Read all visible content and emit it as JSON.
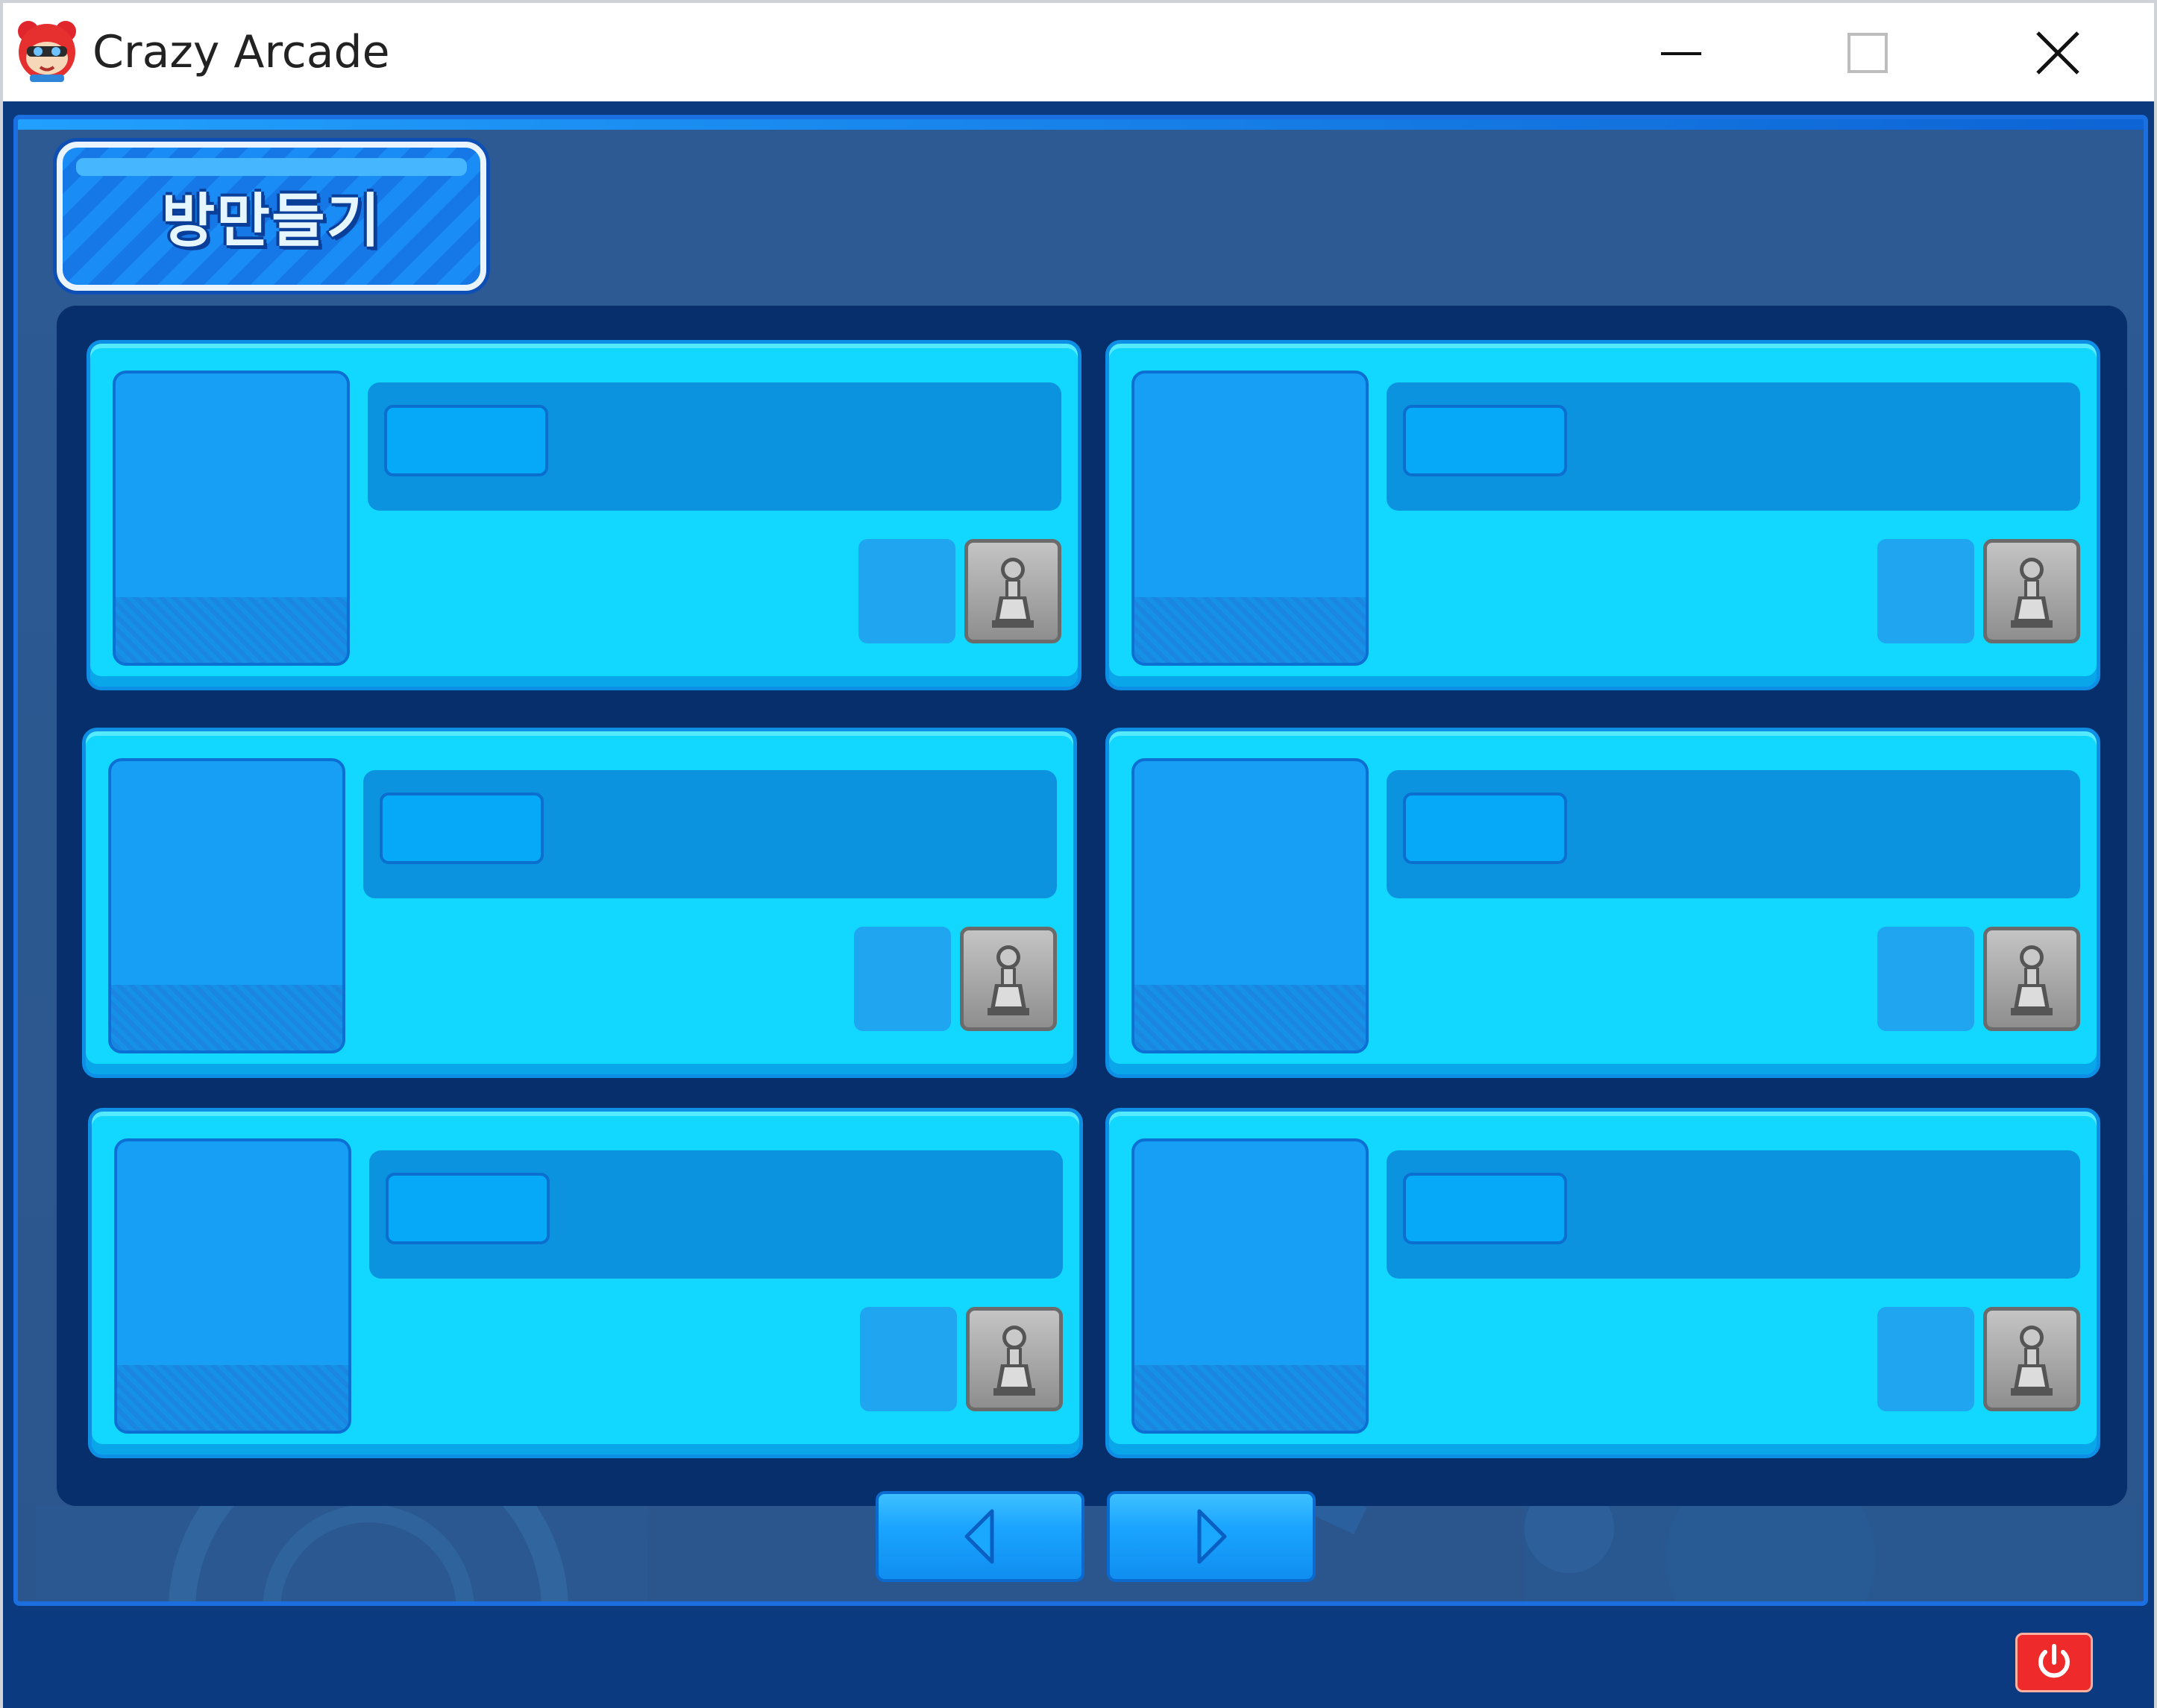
{
  "window": {
    "title": "Crazy Arcade",
    "icon": "app-bear-icon",
    "controls": [
      "minimize-icon",
      "maximize-icon",
      "close-icon"
    ]
  },
  "lobby": {
    "create_room_label": "방만들기",
    "rooms": [
      {
        "slot": 1,
        "number": "",
        "title": "",
        "locked_icon": "lock-icon"
      },
      {
        "slot": 2,
        "number": "",
        "title": "",
        "locked_icon": "lock-icon"
      },
      {
        "slot": 3,
        "number": "",
        "title": "",
        "locked_icon": "lock-icon"
      },
      {
        "slot": 4,
        "number": "",
        "title": "",
        "locked_icon": "lock-icon"
      },
      {
        "slot": 5,
        "number": "",
        "title": "",
        "locked_icon": "lock-icon"
      },
      {
        "slot": 6,
        "number": "",
        "title": "",
        "locked_icon": "lock-icon"
      }
    ],
    "pager": {
      "prev_icon": "arrow-left-icon",
      "next_icon": "arrow-right-icon"
    }
  },
  "footer": {
    "power_icon": "power-icon"
  },
  "colors": {
    "accent": "#12d8ff",
    "panel": "#072f6b",
    "background": "#2d5a93",
    "power": "#ef2a2a"
  }
}
